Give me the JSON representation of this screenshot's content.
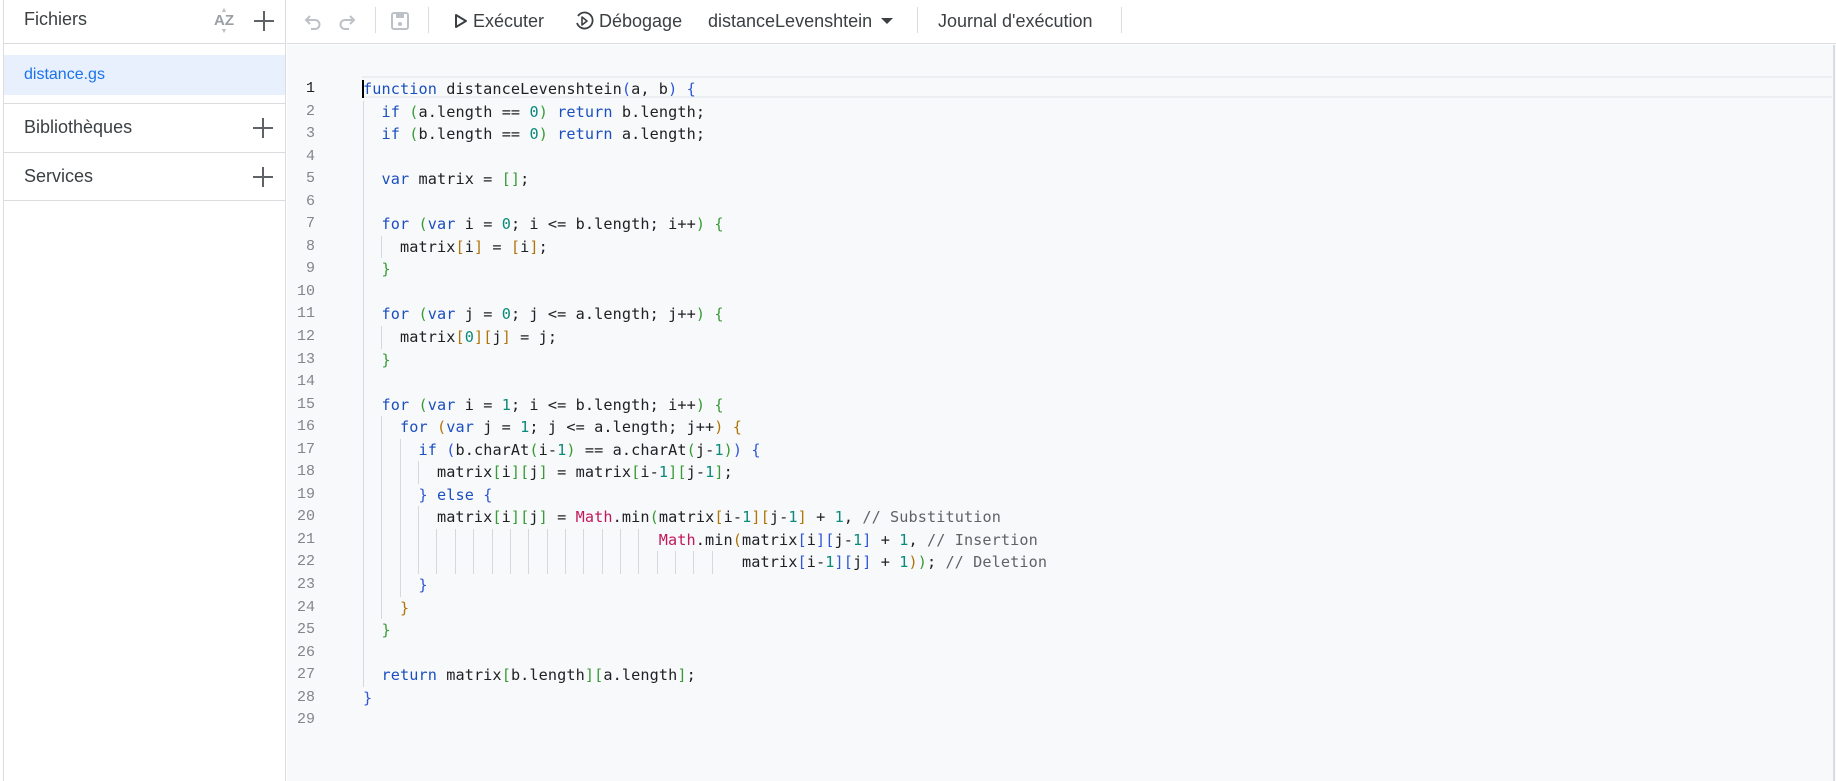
{
  "sidebar": {
    "files_title": "Fichiers",
    "sort_icon_label": "AZ",
    "files": [
      {
        "name": "distance.gs",
        "selected": true
      }
    ],
    "sections": [
      {
        "label": "Bibliothèques"
      },
      {
        "label": "Services"
      }
    ]
  },
  "toolbar": {
    "run_label": "Exécuter",
    "debug_label": "Débogage",
    "function_selector": "distanceLevenshtein",
    "log_label": "Journal d'exécution"
  },
  "editor": {
    "current_line": 1,
    "line_count": 29,
    "colors": {
      "keyword": "#1a4fbf",
      "number": "#0a8a7a",
      "comment": "#5f6368",
      "global": "#c2185b",
      "bracket_level_1": "#2f56d6",
      "bracket_level_2": "#379b36",
      "bracket_level_3": "#b07508"
    },
    "lines": [
      "function distanceLevenshtein(a, b) {",
      "  if (a.length == 0) return b.length;",
      "  if (b.length == 0) return a.length;",
      "",
      "  var matrix = [];",
      "",
      "  for (var i = 0; i <= b.length; i++) {",
      "    matrix[i] = [i];",
      "  }",
      "",
      "  for (var j = 0; j <= a.length; j++) {",
      "    matrix[0][j] = j;",
      "  }",
      "",
      "  for (var i = 1; i <= b.length; i++) {",
      "    for (var j = 1; j <= a.length; j++) {",
      "      if (b.charAt(i-1) == a.charAt(j-1)) {",
      "        matrix[i][j] = matrix[i-1][j-1];",
      "      } else {",
      "        matrix[i][j] = Math.min(matrix[i-1][j-1] + 1, // Substitution",
      "                                Math.min(matrix[i][j-1] + 1, // Insertion",
      "                                         matrix[i-1][j] + 1)); // Deletion",
      "      }",
      "    }",
      "  }",
      "",
      "  return matrix[b.length][a.length];",
      "}",
      ""
    ]
  }
}
